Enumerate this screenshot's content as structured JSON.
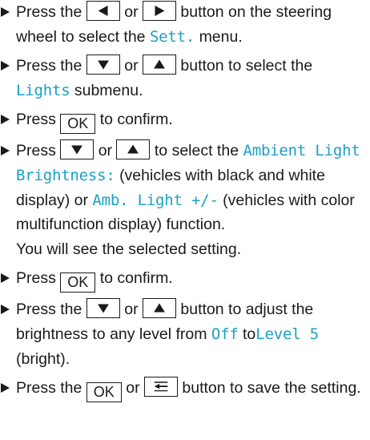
{
  "colors": {
    "text": "#1a1a1a",
    "display_text": "#1aa0c8"
  },
  "steps": [
    {
      "t1": "Press the",
      "t2": "or",
      "t3": "button on the steering wheel to select the",
      "d1": "Sett.",
      "t4": "menu."
    },
    {
      "t1": "Press the",
      "t2": "or",
      "t3": "button to select the",
      "d1": "Lights",
      "t4": "submenu."
    },
    {
      "t1": "Press",
      "ok": "OK",
      "t2": "to confirm."
    },
    {
      "t1": "Press",
      "t2": "or",
      "t3": "to select the",
      "d1": "Ambient Light Brightness:",
      "t4": "(vehicles with black and white display) or",
      "d2": "Amb. Light +/-",
      "t5": "(vehicles with color multifunction display) function.",
      "note": "You will see the selected setting."
    },
    {
      "t1": "Press",
      "ok": "OK",
      "t2": "to confirm."
    },
    {
      "t1": "Press the",
      "t2": "or",
      "t3": "button to adjust the brightness to any level from",
      "d1": "Off",
      "t4": "to",
      "d2": "Level 5",
      "t5": "(bright)."
    },
    {
      "t1": "Press the",
      "ok": "OK",
      "t2": "or",
      "t3": "button to save the setting."
    }
  ],
  "icons": {
    "left": "left-arrow-icon",
    "right": "right-arrow-icon",
    "down": "down-arrow-icon",
    "up": "up-arrow-icon",
    "back": "back-icon"
  }
}
